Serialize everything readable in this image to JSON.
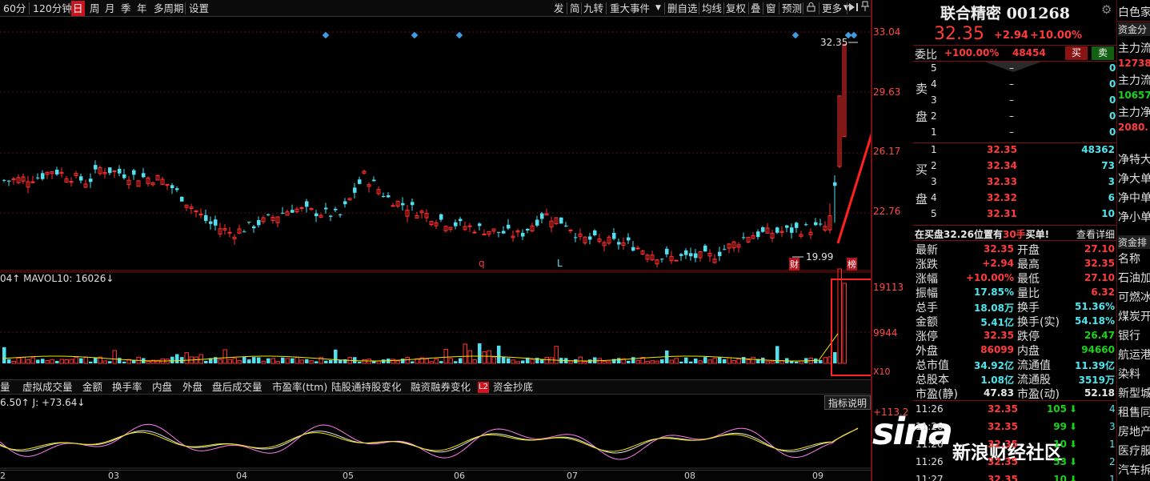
{
  "toolbar": {
    "items": [
      "60分",
      "120分钟",
      "日",
      "周",
      "月",
      "季",
      "年",
      "多周期",
      "设置"
    ],
    "right_items": [
      "发",
      "简",
      "九转",
      "重大事件",
      "删自选",
      "均线",
      "复权",
      "叠",
      "窗",
      "预测",
      "更多"
    ],
    "selected": "日"
  },
  "stock": {
    "name": "联合精密 001268",
    "price": "32.35",
    "change": "+2.94",
    "change_pct": "+10.00%",
    "bid_ratio_label": "委比",
    "bid_ratio": "+100.00%",
    "bid_diff": "48454",
    "buy_btn": "买",
    "sell_btn": "卖",
    "right_label": "白色家"
  },
  "order_book": {
    "sell_label": [
      "卖",
      "盘"
    ],
    "buy_label": [
      "买",
      "盘"
    ],
    "sell": [
      {
        "lvl": "5",
        "price": "–",
        "vol": "0"
      },
      {
        "lvl": "4",
        "price": "–",
        "vol": "0"
      },
      {
        "lvl": "3",
        "price": "–",
        "vol": "0"
      },
      {
        "lvl": "2",
        "price": "–",
        "vol": "0"
      },
      {
        "lvl": "1",
        "price": "–",
        "vol": "0"
      }
    ],
    "buy": [
      {
        "lvl": "1",
        "price": "32.35",
        "vol": "48362"
      },
      {
        "lvl": "2",
        "price": "32.34",
        "vol": "73"
      },
      {
        "lvl": "3",
        "price": "32.33",
        "vol": "3"
      },
      {
        "lvl": "4",
        "price": "32.32",
        "vol": "6"
      },
      {
        "lvl": "5",
        "price": "32.31",
        "vol": "10"
      }
    ],
    "notice": "在买盘32.26位置有",
    "notice_qty": "30手",
    "notice_tail": "买单!",
    "detail_link": "查看详细"
  },
  "stats": [
    {
      "l1": "最新",
      "v1": "32.35",
      "l2": "开盘",
      "v2": "27.10",
      "c1": "red",
      "c2": "red"
    },
    {
      "l1": "涨跌",
      "v1": "+2.94",
      "l2": "最高",
      "v2": "32.35",
      "c1": "red",
      "c2": "red"
    },
    {
      "l1": "涨幅",
      "v1": "+10.00%",
      "l2": "最低",
      "v2": "27.10",
      "c1": "red",
      "c2": "red"
    },
    {
      "l1": "振幅",
      "v1": "17.85%",
      "l2": "量比",
      "v2": "6.32",
      "c1": "cyan",
      "c2": "red"
    },
    {
      "l1": "总手",
      "v1": "18.08万",
      "l2": "换手",
      "v2": "51.36%",
      "c1": "cyan",
      "c2": "cyan"
    },
    {
      "l1": "金额",
      "v1": "5.41亿",
      "l2": "换手(实)",
      "v2": "54.18%",
      "c1": "cyan",
      "c2": "cyan"
    },
    {
      "l1": "涨停",
      "v1": "32.35",
      "l2": "跌停",
      "v2": "26.47",
      "c1": "red",
      "c2": "grn"
    },
    {
      "l1": "外盘",
      "v1": "86099",
      "l2": "内盘",
      "v2": "94660",
      "c1": "red",
      "c2": "grn"
    },
    {
      "l1": "总市值",
      "v1": "34.92亿",
      "l2": "流通值",
      "v2": "11.39亿",
      "c1": "cyan",
      "c2": "cyan"
    },
    {
      "l1": "总股本",
      "v1": "1.08亿",
      "l2": "流通股",
      "v2": "3519万",
      "c1": "cyan",
      "c2": "cyan"
    },
    {
      "l1": "市盈(静)",
      "v1": "47.83",
      "l2": "市盈(动)",
      "v2": "52.18",
      "c1": "white",
      "c2": "white"
    }
  ],
  "ticks": [
    {
      "t": "11:26",
      "p": "32.35",
      "v": "105",
      "n": "4"
    },
    {
      "t": "11:26",
      "p": "32.35",
      "v": "99",
      "n": "3"
    },
    {
      "t": "11:26",
      "p": "32.35",
      "v": "10",
      "n": "1"
    },
    {
      "t": "11:26",
      "p": "32.35",
      "v": "53",
      "n": "2"
    },
    {
      "t": "11:27",
      "p": "32.35",
      "v": "10",
      "n": "1"
    }
  ],
  "far_right": {
    "fund_tab": "资金分",
    "items": [
      {
        "label": "主力流",
        "value": "12738"
      },
      {
        "label": "主力流",
        "value": "10657"
      },
      {
        "label": "主力净",
        "value": "2080."
      }
    ],
    "net": [
      "净特大",
      "净大单",
      "净中单",
      "净小单"
    ],
    "rank_tab": "资金排",
    "col_name": "名称",
    "sectors": [
      "石油加",
      "可燃冰",
      "煤炭开",
      "银行",
      "航运港",
      "染料",
      "新型城",
      "租售同",
      "房地产",
      "医疗服",
      "汽车拆"
    ]
  },
  "chart": {
    "price_axis": [
      "33.04",
      "29.63",
      "26.17",
      "22.76"
    ],
    "high_label": "32.35",
    "low_label": "19.99",
    "markers": [
      "q",
      "L",
      "财",
      "榜"
    ],
    "vol_label": "04↑ MAVOL10: 16026↓",
    "vol_axis": [
      "19113",
      "9944",
      "X10"
    ],
    "kdj_label": "6.50↑ J: +73.64↓",
    "kdj_axis": "+113.2",
    "indicator_btn": "指标说明",
    "months": [
      "2",
      "03",
      "04",
      "05",
      "06",
      "07",
      "08",
      "09"
    ],
    "tabs": [
      "量",
      "虚拟成交量",
      "金额",
      "换手率",
      "内盘",
      "外盘",
      "盘后成交量",
      "市盈率(ttm)",
      "陆股通持股变化",
      "融资融券变化",
      "资金抄底"
    ],
    "l2": "L2"
  },
  "watermark": {
    "logo": "sina",
    "text": "新浪财经社区"
  },
  "chart_data": {
    "type": "candlestick",
    "y_ticks": [
      33.04,
      29.63,
      26.17,
      22.76
    ],
    "last_close": 32.35,
    "period_low": 19.99
  }
}
